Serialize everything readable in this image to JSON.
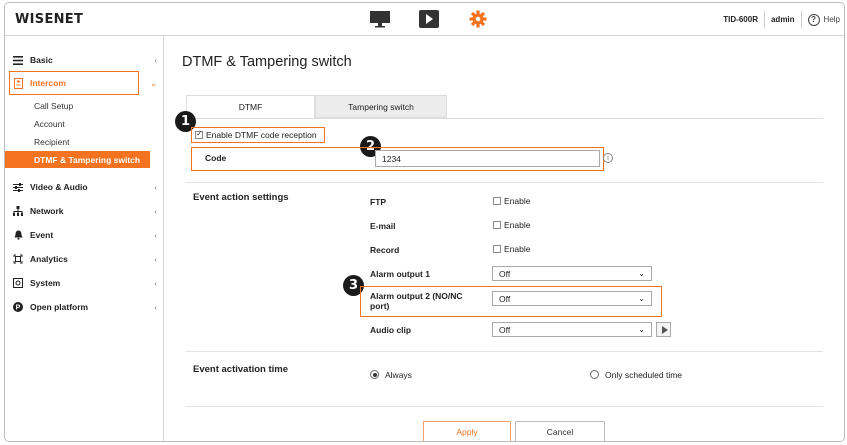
{
  "app": {
    "logo": "WISENET",
    "model": "TID-600R",
    "user": "admin",
    "help": "Help"
  },
  "top_icons": [
    "monitor-icon",
    "play-icon",
    "gear-icon"
  ],
  "colors": {
    "accent": "#f37321",
    "dark": "#1a1a1a"
  },
  "sidebar": {
    "items": [
      {
        "label": "Basic",
        "icon": "list-icon"
      },
      {
        "label": "Intercom",
        "icon": "intercom-icon"
      },
      {
        "label": "Video & Audio",
        "icon": "sliders-icon"
      },
      {
        "label": "Network",
        "icon": "network-icon"
      },
      {
        "label": "Event",
        "icon": "bell-icon"
      },
      {
        "label": "Analytics",
        "icon": "analytics-icon"
      },
      {
        "label": "System",
        "icon": "system-icon"
      },
      {
        "label": "Open platform",
        "icon": "platform-icon"
      }
    ],
    "subitems": [
      "Call Setup",
      "Account",
      "Recipient",
      "DTMF & Tampering switch"
    ]
  },
  "page": {
    "title": "DTMF & Tampering switch"
  },
  "tabs": [
    "DTMF",
    "Tampering switch"
  ],
  "dtmf": {
    "enable_label": "Enable DTMF code reception",
    "code_label": "Code",
    "code_value": "1234"
  },
  "event_action": {
    "section": "Event action settings",
    "enable": "Enable",
    "rows": [
      {
        "label": "FTP"
      },
      {
        "label": "E-mail"
      },
      {
        "label": "Record"
      },
      {
        "label": "Alarm output 1",
        "value": "Off"
      },
      {
        "label": "Alarm output 2 (NO/NC port)",
        "value": "Off"
      },
      {
        "label": "Audio clip",
        "value": "Off"
      }
    ]
  },
  "activation": {
    "section": "Event activation time",
    "always": "Always",
    "scheduled": "Only scheduled time"
  },
  "buttons": {
    "apply": "Apply",
    "cancel": "Cancel"
  },
  "badges": [
    "1",
    "2",
    "3"
  ]
}
